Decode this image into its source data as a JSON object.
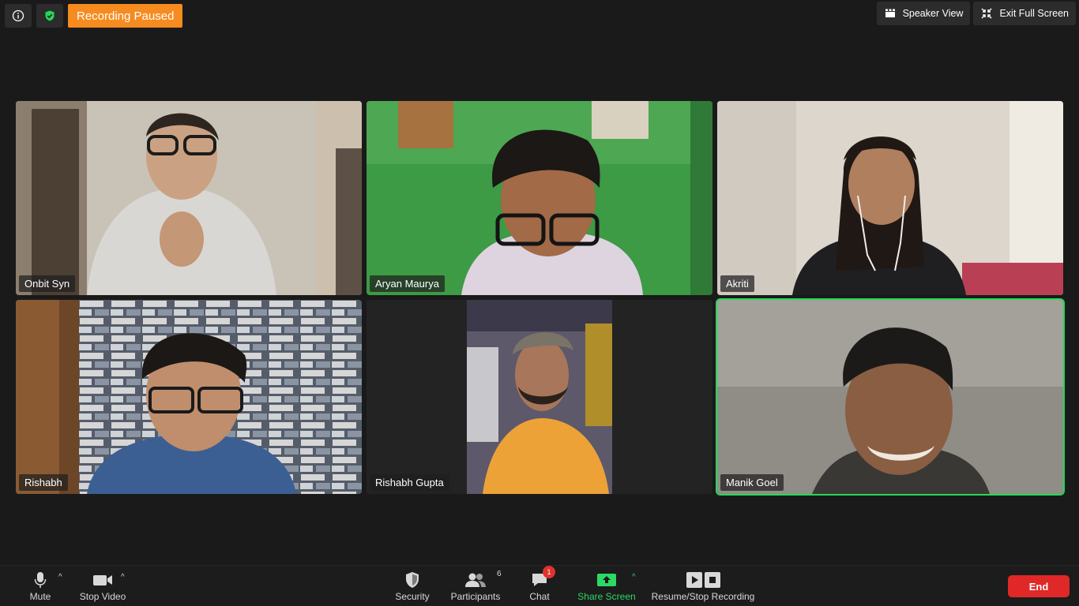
{
  "top_bar": {
    "info_icon": "info-icon",
    "security_icon": "shield-check-icon",
    "recording_status": "Recording Paused",
    "speaker_view_label": "Speaker View",
    "exit_full_screen_label": "Exit Full Screen"
  },
  "participants": [
    {
      "name": "Onbit Syn"
    },
    {
      "name": "Aryan Maurya"
    },
    {
      "name": "Akriti"
    },
    {
      "name": "Rishabh"
    },
    {
      "name": "Rishabh Gupta"
    },
    {
      "name": "Manik Goel",
      "active_speaker": true
    }
  ],
  "toolbar": {
    "mute_label": "Mute",
    "stop_video_label": "Stop Video",
    "security_label": "Security",
    "participants_label": "Participants",
    "participants_count": "6",
    "chat_label": "Chat",
    "chat_unread": "1",
    "share_screen_label": "Share Screen",
    "recording_label": "Resume/Stop Recording",
    "end_label": "End"
  },
  "colors": {
    "recording_badge": "#f68b1f",
    "active_speaker_border": "#23d959",
    "share_screen": "#2bd964",
    "end_button": "#e02828",
    "chat_badge": "#e0322e"
  }
}
